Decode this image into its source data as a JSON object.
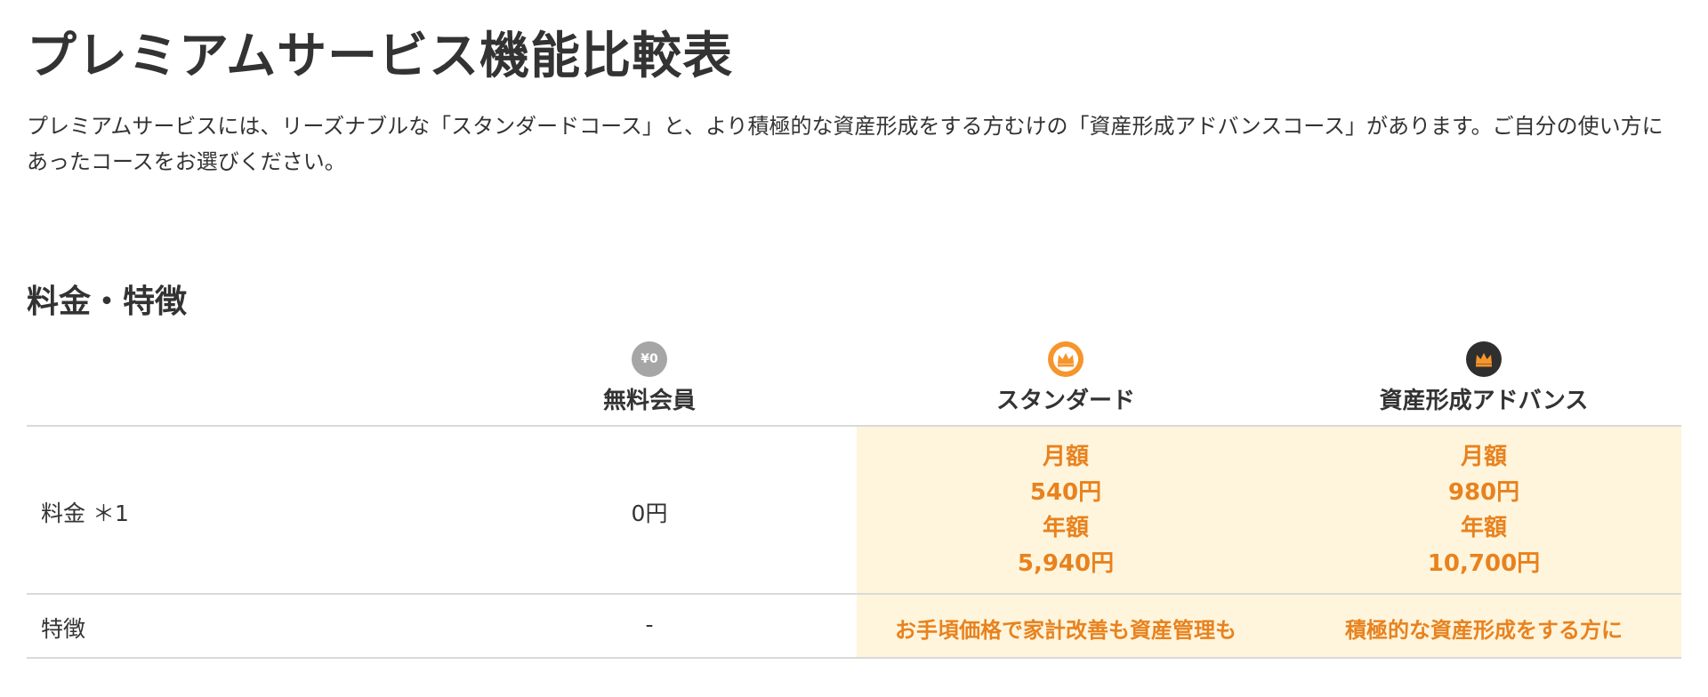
{
  "page": {
    "title": "プレミアムサービス機能比較表",
    "intro": "プレミアムサービスには、リーズナブルな「スタンダードコース」と、より積極的な資産形成をする方むけの「資産形成アドバンスコース」があります。ご自分の使い方にあったコースをお選びください。"
  },
  "section": {
    "title": "料金・特徴"
  },
  "plans": {
    "free": {
      "name": "無料会員",
      "badge_text": "¥0",
      "badge_color": "#a6a6a6",
      "icon": "yen-zero-badge-icon"
    },
    "standard": {
      "name": "スタンダード",
      "badge_color": "#f6952b",
      "icon": "crown-icon"
    },
    "advance": {
      "name": "資産形成アドバンス",
      "badge_color": "#2f2f2f",
      "icon": "crown-icon"
    }
  },
  "rows": {
    "price": {
      "label": "料金 ＊1",
      "free": "0円",
      "standard": {
        "monthly_label": "月額",
        "monthly": "540円",
        "yearly_label": "年額",
        "yearly": "5,940円"
      },
      "advance": {
        "monthly_label": "月額",
        "monthly": "980円",
        "yearly_label": "年額",
        "yearly": "10,700円"
      }
    },
    "feature": {
      "label": "特徴",
      "free": "-",
      "standard": "お手頃価格で家計改善も資産管理も",
      "advance": "積極的な資産形成をする方に"
    }
  },
  "colors": {
    "accent": "#e8821e",
    "highlight_bg": "#fff5dd",
    "border": "#d9d9d9",
    "text": "#333333"
  }
}
